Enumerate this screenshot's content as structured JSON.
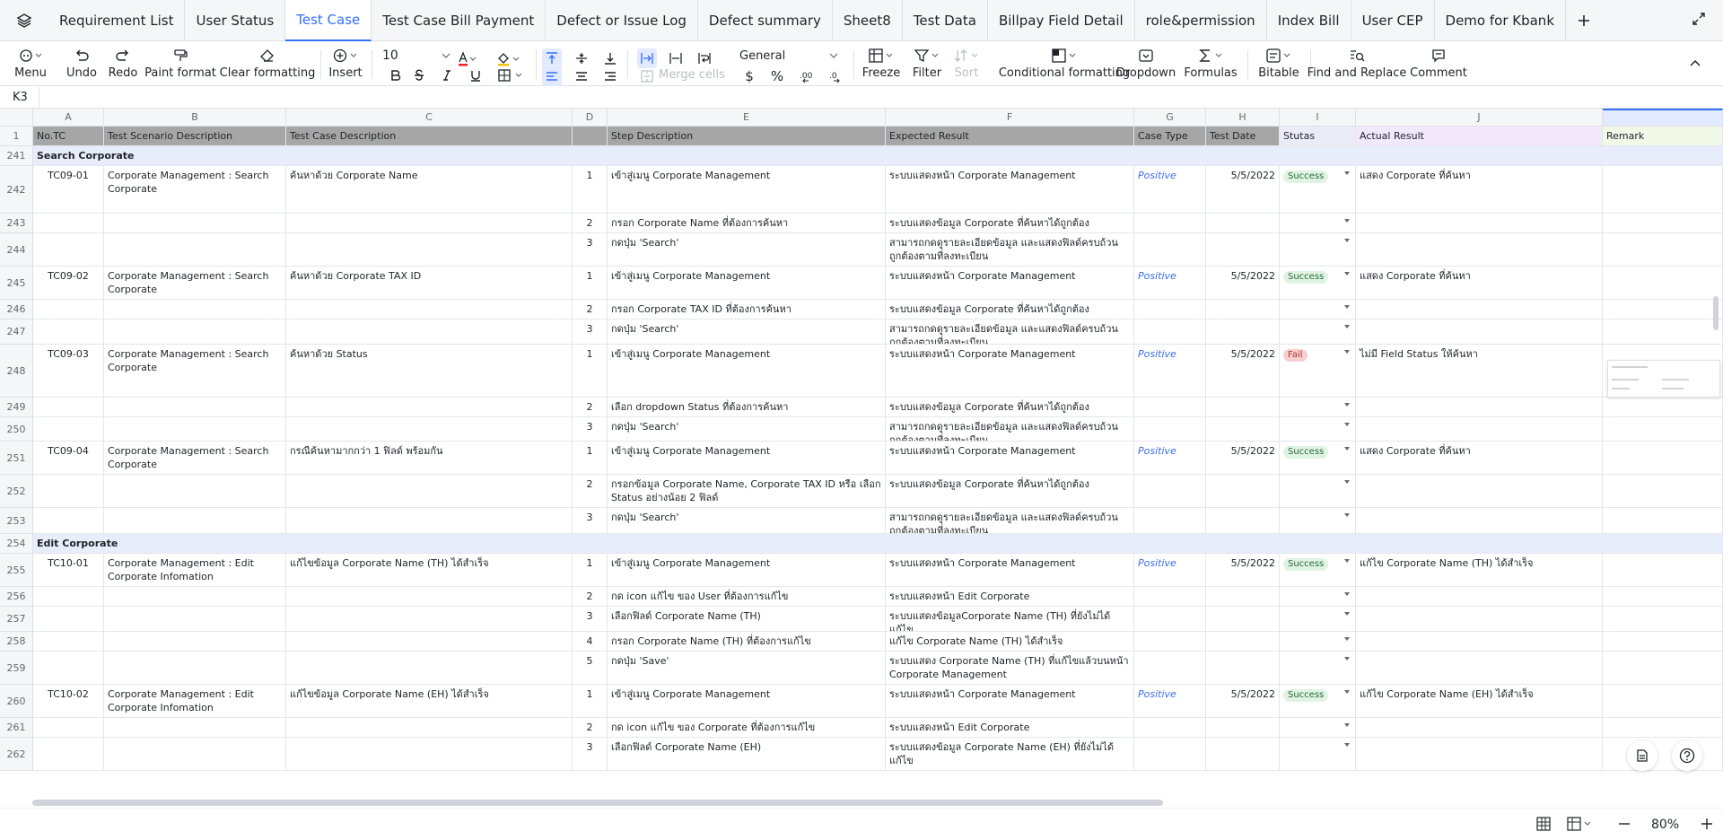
{
  "tabs": [
    {
      "label": "Requirement List"
    },
    {
      "label": "User Status"
    },
    {
      "label": "Test Case"
    },
    {
      "label": "Test Case Bill Payment"
    },
    {
      "label": "Defect or Issue Log"
    },
    {
      "label": "Defect summary"
    },
    {
      "label": "Sheet8"
    },
    {
      "label": "Test Data"
    },
    {
      "label": "Billpay Field Detail"
    },
    {
      "label": "role&permission"
    },
    {
      "label": "Index Bill"
    },
    {
      "label": "User CEP"
    },
    {
      "label": "Demo for Kbank"
    }
  ],
  "active_tab": "Test Case",
  "toolbar": {
    "menu": "Menu",
    "undo": "Undo",
    "redo": "Redo",
    "paint": "Paint format",
    "clear": "Clear formatting",
    "insert": "Insert",
    "font_size": "10",
    "number_format": "General",
    "merge": "Merge cells",
    "freeze": "Freeze",
    "filter": "Filter",
    "sort": "Sort",
    "conditional": "Conditional formatting",
    "dropdown": "Dropdown",
    "formulas": "Formulas",
    "bitable": "Bitable",
    "find": "Find and Replace",
    "comment": "Comment",
    "currency": "$",
    "percent": "%"
  },
  "formula_bar": {
    "cell_ref": "K3"
  },
  "columns": [
    "A",
    "B",
    "C",
    "D",
    "E",
    "F",
    "G",
    "H",
    "I",
    "J"
  ],
  "row1": {
    "num": "1",
    "headers": [
      "No.TC",
      "Test Scenario Description",
      "Test Case Description",
      "",
      "Step Description",
      "Expected Result",
      "Case Type",
      "Test Date",
      "Stutas",
      "Actual Result",
      "Remark"
    ]
  },
  "rows": [
    {
      "n": "241",
      "section": "Search Corporate"
    },
    {
      "n": "242",
      "a": "TC09-01",
      "b": "Corporate Management : Search Corporate",
      "c": "ค้นหาด้วย Corporate Name",
      "d": "1",
      "e": "เข้าสู่เมนู Corporate Management",
      "f": "ระบบแสดงหน้า Corporate Management",
      "g": "Positive",
      "h": "5/5/2022",
      "i": "Success",
      "j": "แสดง Corporate ที่ค้นหา"
    },
    {
      "n": "243",
      "d": "2",
      "e": "กรอก Corporate Name ที่ต้องการค้นหา",
      "f": "ระบบแสดงข้อมูล Corporate ที่ค้นหาได้ถูกต้อง"
    },
    {
      "n": "244",
      "d": "3",
      "e": "กดปุ่ม 'Search'",
      "f": "สามารถกดดูรายละเอียดข้อมูล และแสดงฟิลด์ครบถ้วนถูกต้องตามที่ลงทะเบียน"
    },
    {
      "n": "245",
      "a": "TC09-02",
      "b": "Corporate Management : Search Corporate",
      "c": "ค้นหาด้วย Corporate TAX ID",
      "d": "1",
      "e": "เข้าสู่เมนู Corporate Management",
      "f": "ระบบแสดงหน้า Corporate Management",
      "g": "Positive",
      "h": "5/5/2022",
      "i": "Success",
      "j": "แสดง Corporate ที่ค้นหา"
    },
    {
      "n": "246",
      "d": "2",
      "e": "กรอก Corporate TAX ID ที่ต้องการค้นหา",
      "f": "ระบบแสดงข้อมูล Corporate ที่ค้นหาได้ถูกต้อง"
    },
    {
      "n": "247",
      "d": "3",
      "e": "กดปุ่ม 'Search'",
      "f": "สามารถกดดูรายละเอียดข้อมูล และแสดงฟิลด์ครบถ้วนถูกต้องตามที่ลงทะเบียน"
    },
    {
      "n": "248",
      "a": "TC09-03",
      "b": "Corporate Management : Search Corporate",
      "c": "ค้นหาด้วย Status",
      "d": "1",
      "e": "เข้าสู่เมนู Corporate Management",
      "f": "ระบบแสดงหน้า Corporate Management",
      "g": "Positive",
      "h": "5/5/2022",
      "i": "Fail",
      "j": "ไม่มี Field Status ให้ค้นหา"
    },
    {
      "n": "249",
      "d": "2",
      "e": "เลือก dropdown Status ที่ต้องการค้นหา",
      "f": "ระบบแสดงข้อมูล Corporate ที่ค้นหาได้ถูกต้อง"
    },
    {
      "n": "250",
      "d": "3",
      "e": "กดปุ่ม 'Search'",
      "f": "สามารถกดดูรายละเอียดข้อมูล และแสดงฟิลด์ครบถ้วนถูกต้องตามที่ลงทะเบียน"
    },
    {
      "n": "251",
      "a": "TC09-04",
      "b": "Corporate Management : Search Corporate",
      "c": "กรณีค้นหามากกว่า 1 ฟิลด์ พร้อมกัน",
      "d": "1",
      "e": "เข้าสู่เมนู Corporate Management",
      "f": "ระบบแสดงหน้า Corporate Management",
      "g": "Positive",
      "h": "5/5/2022",
      "i": "Success",
      "j": "แสดง Corporate ที่ค้นหา"
    },
    {
      "n": "252",
      "d": "2",
      "e": "กรอกข้อมูล Corporate Name, Corporate TAX ID หรือ เลือก Status อย่างน้อย 2 ฟิลด์",
      "f": "ระบบแสดงข้อมูล Corporate ที่ค้นหาได้ถูกต้อง"
    },
    {
      "n": "253",
      "d": "3",
      "e": "กดปุ่ม 'Search'",
      "f": "สามารถกดดูรายละเอียดข้อมูล และแสดงฟิลด์ครบถ้วนถูกต้องตามที่ลงทะเบียน"
    },
    {
      "n": "254",
      "section": "Edit Corporate"
    },
    {
      "n": "255",
      "a": "TC10-01",
      "b": "Corporate Management : Edit Corporate Infomation",
      "c": "แก้ไขข้อมูล Corporate Name (TH) ได้สำเร็จ",
      "d": "1",
      "e": "เข้าสู่เมนู Corporate Management",
      "f": "ระบบแสดงหน้า Corporate Management",
      "g": "Positive",
      "h": "5/5/2022",
      "i": "Success",
      "j": "แก้ไข Corporate Name (TH) ได้สำเร็จ"
    },
    {
      "n": "256",
      "d": "2",
      "e": "กด icon แก้ไข ของ User ที่ต้องการแก้ไข",
      "f": "ระบบแสดงหน้า Edit Corporate"
    },
    {
      "n": "257",
      "d": "3",
      "e": "เลือกฟิลด์ Corporate Name (TH)",
      "f": "ระบบแสดงข้อมูลCorporate Name (TH) ที่ยังไม่ได้แก้ไข"
    },
    {
      "n": "258",
      "d": "4",
      "e": "กรอก Corporate Name (TH)  ที่ต้องการแก้ไข",
      "f": "แก้ไข Corporate Name (TH) ได้สำเร็จ"
    },
    {
      "n": "259",
      "d": "5",
      "e": "กดปุ่ม 'Save'",
      "f": "ระบบแสดง Corporate Name (TH) ที่แก้ไขแล้วบนหน้า Corporate Management"
    },
    {
      "n": "260",
      "a": "TC10-02",
      "b": "Corporate Management : Edit Corporate Infomation",
      "c": "แก้ไขข้อมูล Corporate Name (EH) ได้สำเร็จ",
      "d": "1",
      "e": "เข้าสู่เมนู Corporate Management",
      "f": "ระบบแสดงหน้า Corporate Management",
      "g": "Positive",
      "h": "5/5/2022",
      "i": "Success",
      "j": "แก้ไข Corporate Name (EH) ได้สำเร็จ"
    },
    {
      "n": "261",
      "d": "2",
      "e": "กด icon แก้ไข ของ Corporate ที่ต้องการแก้ไข",
      "f": "ระบบแสดงหน้า Edit Corporate"
    },
    {
      "n": "262",
      "d": "3",
      "e": "เลือกฟิลด์ Corporate Name (EH)",
      "f": "ระบบแสดงข้อมูล Corporate Name (EH) ที่ยังไม่ได้แก้ไข"
    }
  ],
  "footer": {
    "zoom": "80%"
  },
  "colors": {
    "accent": "#3370ff",
    "header_gray": "#a6a6a6",
    "section_blue": "#e8edfb",
    "positive_blue": "#3a6ee8",
    "success_bg": "#dff4e2",
    "fail_bg": "#f8cfcf"
  }
}
